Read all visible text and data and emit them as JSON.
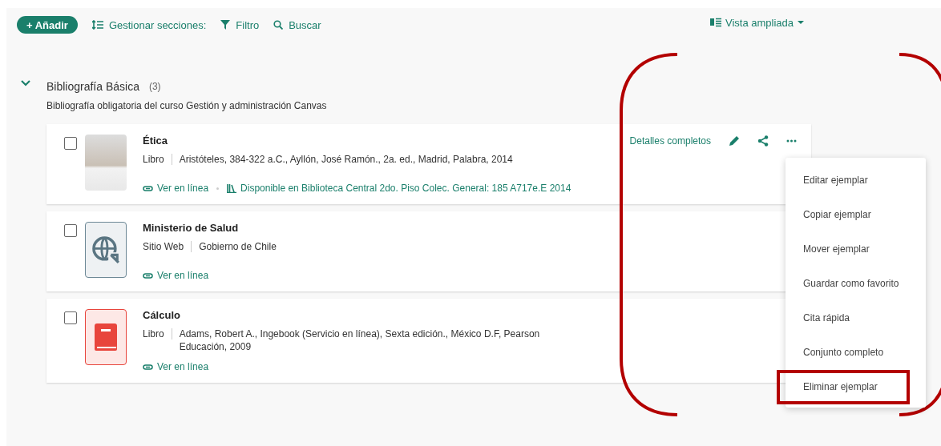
{
  "toolbar": {
    "add_button": "+ Añadir",
    "manage_sections": "Gestionar secciones:",
    "filter": "Filtro",
    "search": "Buscar",
    "view": "Vista ampliada"
  },
  "section": {
    "title": "Bibliografía Básica",
    "count": "(3)",
    "expanded": true,
    "description": "Bibliografía obligatoria del curso Gestión y administración Canvas"
  },
  "items": [
    {
      "kind": "cover",
      "title": "Ética",
      "checked": false,
      "type": "Libro",
      "details": "Aristóteles, 384-322 a.C., Ayllón, José Ramón., 2a. ed., Madrid, Palabra, 2014",
      "link": "Ver en línea",
      "availability": "Disponible en Biblioteca Central 2do. Piso Colec. General: 185 A717e.E 2014",
      "actions": {
        "details": "Detalles completos"
      }
    },
    {
      "kind": "web",
      "title": "Ministerio de Salud",
      "checked": false,
      "type": "Sitio Web",
      "details": "Gobierno de Chile",
      "link": "Ver en línea"
    },
    {
      "kind": "book",
      "title": "Cálculo",
      "checked": false,
      "type": "Libro",
      "details": "Adams, Robert A., Ingebook (Servicio en línea), Sexta edición., México D.F, Pearson Educación, 2009",
      "link": "Ver en línea"
    }
  ],
  "menu": [
    {
      "label": "Editar ejemplar",
      "highlighted": false
    },
    {
      "label": "Copiar ejemplar",
      "highlighted": false
    },
    {
      "label": "Mover ejemplar",
      "highlighted": false
    },
    {
      "label": "Guardar como favorito",
      "highlighted": false
    },
    {
      "label": "Cita rápida",
      "highlighted": false
    },
    {
      "label": "Conjunto completo",
      "highlighted": false
    },
    {
      "label": "Eliminar ejemplar",
      "highlighted": true
    }
  ]
}
